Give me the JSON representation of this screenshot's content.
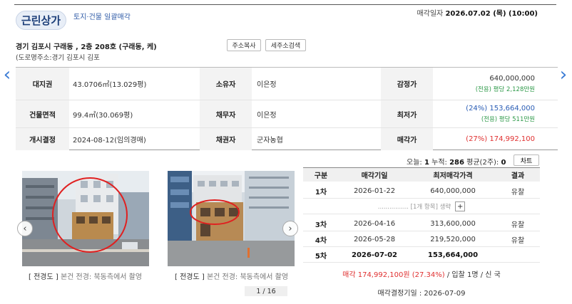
{
  "header": {
    "badge": "근린상가",
    "subtitle": "토지·건물 일괄매각",
    "sale_date_label": "매각일자",
    "sale_date_value": "2026.07.02 (목) (10:00)",
    "address": "경기 김포시 구래동             , 2층 208호 (구래동,                      케)",
    "road_address": "(도로명주소:경기 김포시 김포",
    "copy_btn": "주소복사",
    "tax_btn": "세주소검색"
  },
  "nav": {
    "prev": "‹",
    "next": "›"
  },
  "info": {
    "land_label": "대지권",
    "land_value": "43.0706㎡(13.029평)",
    "owner_label": "소유자",
    "owner_value": "이은정",
    "appraisal_label": "감정가",
    "appraisal_value": "640,000,000",
    "appraisal_sub": "(전용) 평당 2,128만원",
    "building_label": "건물면적",
    "building_value": "99.4㎡(30.069평)",
    "debtor_label": "채무자",
    "debtor_value": "이은정",
    "min_label": "최저가",
    "min_value": "(24%) 153,664,000",
    "min_sub": "(전용) 평당 511만원",
    "start_label": "개시결정",
    "start_value": "2024-08-12(임의경매)",
    "creditor_label": "채권자",
    "creditor_value": "군자농협",
    "sold_label": "매각가",
    "sold_value": "(27%) 174,992,100"
  },
  "stats": {
    "today_label": "오늘:",
    "today": "1",
    "total_label": "누적:",
    "total": "286",
    "avg_label": "평균(2주):",
    "avg": "0",
    "chart_btn": "차트"
  },
  "photos": [
    {
      "caption_bracket": "[ 전경도 ]",
      "caption": " 본건 전경: 북동측에서 촬영"
    },
    {
      "caption_bracket": "[ 전경도 ]",
      "caption": " 본건 전경: 북동측에서 촬영"
    }
  ],
  "carousel": {
    "left": "‹",
    "right": "›",
    "pager": "1 / 16"
  },
  "history": {
    "headers": {
      "round": "구분",
      "date": "매각기일",
      "price": "최저매각가격",
      "result": "결과"
    },
    "rows": [
      {
        "round": "1차",
        "date": "2026-01-22",
        "price": "640,000,000",
        "result": "유찰"
      },
      {
        "round": "3차",
        "date": "2026-04-16",
        "price": "313,600,000",
        "result": "유찰"
      },
      {
        "round": "4차",
        "date": "2026-05-28",
        "price": "219,520,000",
        "result": "유찰"
      },
      {
        "round": "5차",
        "date": "2026-07-02",
        "price": "153,664,000",
        "result": ""
      }
    ],
    "collapsed_text": "................ [1개 항목] 생략",
    "expand_btn": "+",
    "sold_red": "매각 174,992,100원 (27.34%)",
    "sold_rest": " / 입찰 1명 / 신    국",
    "decision": "매각결정기일 : 2026-07-09"
  },
  "colors": {
    "accent_blue": "#2a5db5",
    "price_red": "#e03030",
    "sub_green": "#2f9a4a"
  }
}
